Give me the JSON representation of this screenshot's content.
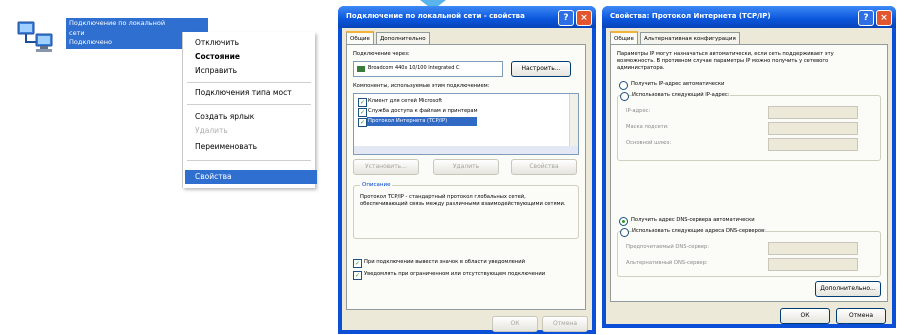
{
  "connection": {
    "lines": [
      "Подключение по локальной",
      "сети",
      "Подключено"
    ]
  },
  "context_menu": {
    "items": [
      {
        "label": "Отключить",
        "style": "normal"
      },
      {
        "label": "Состояние",
        "style": "bold"
      },
      {
        "label": "Исправить",
        "style": "normal"
      },
      {
        "label": "Подключения типа мост",
        "style": "normal"
      },
      {
        "label": "Создать ярлык",
        "style": "normal"
      },
      {
        "label": "Удалить",
        "style": "disabled"
      },
      {
        "label": "Переименовать",
        "style": "normal"
      },
      {
        "label": "Свойства",
        "style": "selected"
      }
    ]
  },
  "window1": {
    "title": "Подключение по локальной сети - свойства",
    "tabs": [
      "Общие",
      "Дополнительно"
    ],
    "connect_via_label": "Подключение через:",
    "adapter_name": "Broadcom 440x 10/100 Integrated C",
    "configure_button": "Настроить...",
    "components_label": "Компоненты, используемые этим подключением:",
    "components": [
      {
        "checked": true,
        "label": "Клиент для сетей Microsoft"
      },
      {
        "checked": true,
        "label": "Служба доступа к файлам и принтерам"
      },
      {
        "checked": true,
        "label": "Протокол Интернета (TCP/IP)"
      }
    ],
    "install_button": "Установить...",
    "uninstall_button": "Удалить",
    "properties_button": "Свойства",
    "description_title": "Описание",
    "description_text": "Протокол TCP/IP - стандартный протокол глобальных сетей, обеспечивающий связь между различными взаимодействующими сетями.",
    "show_icon_label": "При подключении вывести значок в области уведомлений",
    "notify_label": "Уведомлять при ограниченном или отсутствующем подключении",
    "ok_button": "ОК",
    "cancel_button": "Отмена"
  },
  "window2": {
    "title": "Свойства: Протокол Интернета (TCP/IP)",
    "tabs": [
      "Общие",
      "Альтернативная конфигурация"
    ],
    "intro_text": "Параметры IP могут назначаться автоматически, если сеть поддерживает эту возможность. В противном случае параметры IP можно получить у сетевого администратора.",
    "auto_ip_label": "Получить IP-адрес автоматически",
    "manual_ip_label": "Использовать следующий IP-адрес:",
    "ip_fields": [
      "IP-адрес:",
      "Маска подсети:",
      "Основной шлюз:"
    ],
    "auto_dns_label": "Получить адрес DNS-сервера автоматически",
    "manual_dns_label": "Использовать следующие адреса DNS-серверов:",
    "dns_fields": [
      "Предпочитаемый DNS-сервер:",
      "Альтернативный DNS-сервер:"
    ],
    "advanced_button": "Дополнительно...",
    "ok_button": "ОК",
    "cancel_button": "Отмена"
  },
  "colors": {
    "xp_title_blue": "#0a56dc",
    "selection_blue": "#2f6fd0",
    "dialog_face": "#ece9d8",
    "close_red": "#e2562f"
  }
}
